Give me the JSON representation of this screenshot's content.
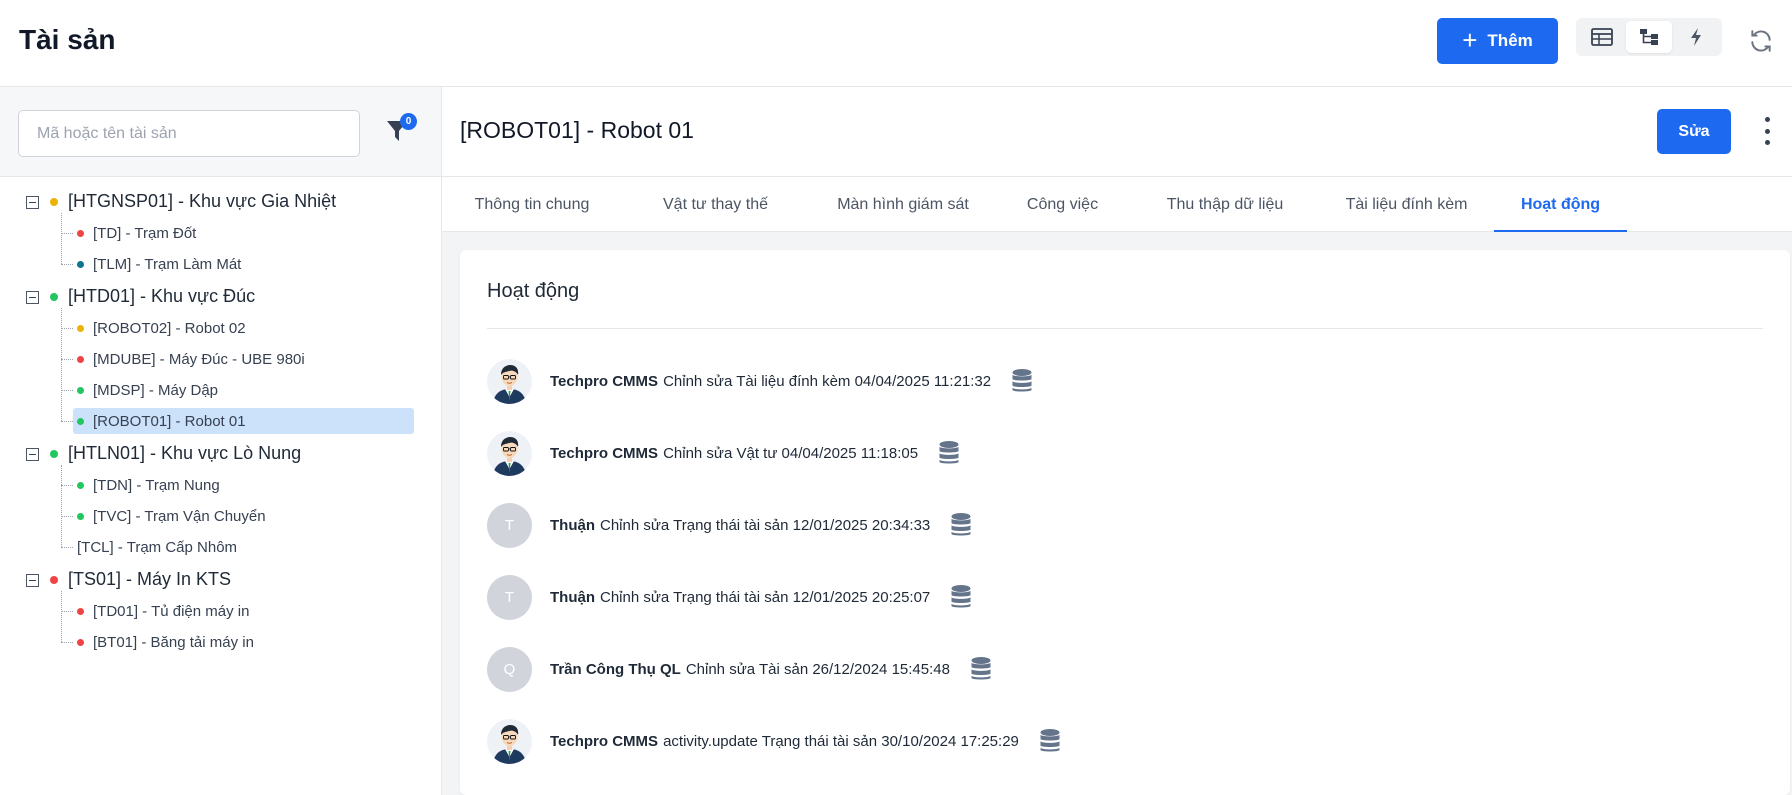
{
  "header": {
    "title": "Tài sản",
    "add_label": "Thêm",
    "views": [
      {
        "icon": "table-view-icon"
      },
      {
        "icon": "tree-view-icon",
        "active": true
      },
      {
        "icon": "lightning-icon"
      }
    ],
    "refresh_icon": "refresh-icon"
  },
  "sidebar": {
    "search_placeholder": "Mã hoặc tên tài sản",
    "filter_count": "0",
    "tree": [
      {
        "label": "[HTGNSP01] - Khu vực Gia Nhiệt",
        "status": "#eab308",
        "children": [
          {
            "label": "[TD] - Trạm Đốt",
            "status": "#ef4444"
          },
          {
            "label": "[TLM] - Trạm Làm Mát",
            "status": "#0e7490"
          }
        ]
      },
      {
        "label": "[HTD01] - Khu vực Đúc",
        "status": "#22c55e",
        "children": [
          {
            "label": "[ROBOT02] - Robot 02",
            "status": "#eab308"
          },
          {
            "label": "[MDUBE] - Máy Đúc - UBE 980i",
            "status": "#ef4444"
          },
          {
            "label": "[MDSP] - Máy Dập",
            "status": "#22c55e"
          },
          {
            "label": "[ROBOT01] - Robot 01",
            "status": "#22c55e",
            "selected": true
          }
        ]
      },
      {
        "label": "[HTLN01] - Khu vực Lò Nung",
        "status": "#22c55e",
        "children": [
          {
            "label": "[TDN] - Trạm Nung",
            "status": "#22c55e"
          },
          {
            "label": "[TVC] - Trạm Vận Chuyển",
            "status": "#22c55e"
          },
          {
            "label": "[TCL] - Trạm Cấp Nhôm",
            "status": null
          }
        ]
      },
      {
        "label": "[TS01] - Máy In KTS",
        "status": "#ef4444",
        "children": [
          {
            "label": "[TD01] - Tủ điện máy in",
            "status": "#ef4444"
          },
          {
            "label": "[BT01] - Băng tải máy in",
            "status": "#ef4444"
          }
        ]
      }
    ]
  },
  "detail": {
    "title": "[ROBOT01] - Robot 01",
    "edit_label": "Sửa",
    "tabs": [
      {
        "label": "Thông tin chung"
      },
      {
        "label": "Vật tư thay thế"
      },
      {
        "label": "Màn hình giám sát"
      },
      {
        "label": "Công việc"
      },
      {
        "label": "Thu thập dữ liệu"
      },
      {
        "label": "Tài liệu đính kèm"
      },
      {
        "label": "Hoạt động",
        "active": true
      }
    ],
    "activity_title": "Hoạt động",
    "activities": [
      {
        "user": "Techpro CMMS",
        "avatar": "photo",
        "text": "Chỉnh sửa Tài liệu đính kèm 04/04/2025 11:21:32"
      },
      {
        "user": "Techpro CMMS",
        "avatar": "photo",
        "text": "Chỉnh sửa Vật tư 04/04/2025 11:18:05"
      },
      {
        "user": "Thuận",
        "avatar": "T",
        "text": "Chỉnh sửa Trạng thái tài sản 12/01/2025 20:34:33"
      },
      {
        "user": "Thuận",
        "avatar": "T",
        "text": "Chỉnh sửa Trạng thái tài sản 12/01/2025 20:25:07"
      },
      {
        "user": "Trần Công Thụ QL",
        "avatar": "Q",
        "text": "Chỉnh sửa Tài sản 26/12/2024 15:45:48"
      },
      {
        "user": "Techpro CMMS",
        "avatar": "photo",
        "text": "activity.update Trạng thái tài sản 30/10/2024 17:25:29"
      }
    ]
  },
  "colors": {
    "accent": "#1d6af0",
    "selected_bg": "#cce2fb"
  }
}
